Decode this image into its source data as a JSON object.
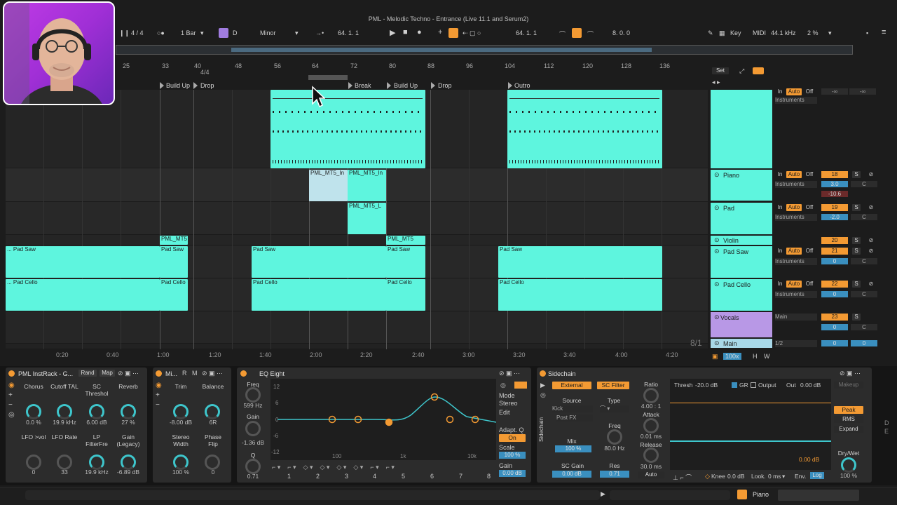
{
  "window": {
    "title": "PML - Melodic Techno - Entrance (Live 11.1 and Serum2)"
  },
  "transport": {
    "time_sig": "4 / 4",
    "quantize": "1 Bar",
    "key": "D",
    "scale": "Minor",
    "position": "64.  1.  1",
    "loop_start": "64.  1.  1",
    "loop_length": "8.  0.  0",
    "key_label": "Key",
    "midi_label": "MIDI",
    "sample_rate": "44.1 kHz",
    "cpu": "2 %"
  },
  "ruler": {
    "bars": [
      "25",
      "33",
      "40",
      "48",
      "56",
      "64",
      "72",
      "80",
      "88",
      "96",
      "104",
      "112",
      "120",
      "128",
      "136"
    ],
    "time_sig_marker": "4/4"
  },
  "locators": [
    "Build Up",
    "Drop",
    "Break",
    "Build Up",
    "Drop",
    "Outro"
  ],
  "clips": {
    "midi_name": "PML_MT5_In",
    "midi_name_2": "PML_MT5_In",
    "midi_name_3": "PML_MT5_L",
    "mt5_short": "PML_MT5",
    "pad_saw": "Pad Saw",
    "pad_cello": "Pad Cello",
    "pad_saw_prefix": "... Pad Saw",
    "pad_cello_prefix": "... Pad Cello"
  },
  "time_ruler": [
    "0:20",
    "0:40",
    "1:00",
    "1:20",
    "1:40",
    "2:00",
    "2:20",
    "2:40",
    "3:00",
    "3:20",
    "3:40",
    "4:00",
    "4:20"
  ],
  "mixer": {
    "set_label": "Set",
    "in": "In",
    "auto": "Auto",
    "off": "Off",
    "instruments": "Instruments",
    "neg_inf": "-∞",
    "tracks": [
      {
        "name": "Piano",
        "number": "18",
        "vol": "3.0",
        "pan": "C",
        "meter": "-10.6"
      },
      {
        "name": "Pad",
        "number": "19",
        "vol": "-2.0",
        "pan": "C",
        "meter": ""
      },
      {
        "name": "Violin",
        "number": "20"
      },
      {
        "name": "Pad Saw",
        "number": "21",
        "vol": "0",
        "pan": "C"
      },
      {
        "name": "Pad Cello",
        "number": "22",
        "vol": "0",
        "pan": "C"
      },
      {
        "name": "Vocals",
        "number": "23",
        "vol": "0",
        "pan": "C",
        "output": "Main"
      },
      {
        "name": "Main",
        "output": "1/2",
        "vol": "0",
        "pan": "0"
      }
    ],
    "s": "S",
    "c": "C",
    "ratio_display": "8/1",
    "zoom": "100x",
    "h": "H",
    "w": "W"
  },
  "devices": {
    "instrack": {
      "title": "PML InstRack - G...",
      "rand": "Rand",
      "map": "Map",
      "params": [
        {
          "label": "Chorus",
          "value": "0.0 %"
        },
        {
          "label": "Cutoff TAL",
          "value": "19.9 kHz"
        },
        {
          "label": "SC Threshol",
          "value": "6.00 dB"
        },
        {
          "label": "Reverb",
          "value": "27 %"
        },
        {
          "label": "LFO >vol",
          "value": "0"
        },
        {
          "label": "LFO Rate",
          "value": "33"
        },
        {
          "label": "LP FilterFre",
          "value": "19.9 kHz"
        },
        {
          "label": "Gain (Legacy)",
          "value": "-6.89 dB"
        }
      ]
    },
    "utility": {
      "title": "Mi...",
      "r": "R",
      "m": "M",
      "params": [
        {
          "label": "Trim",
          "value": "-8.00 dB"
        },
        {
          "label": "Balance",
          "value": "6R"
        },
        {
          "label": "Stereo Width",
          "value": "100 %"
        },
        {
          "label": "Phase Flip",
          "value": "0"
        }
      ]
    },
    "eq": {
      "title": "EQ Eight",
      "freq_label": "Freq",
      "freq_value": "599 Hz",
      "gain_label": "Gain",
      "gain_value": "-1.36 dB",
      "q_label": "Q",
      "q_value": "0.71",
      "db_ticks": [
        "12",
        "6",
        "0",
        "-6",
        "-12"
      ],
      "freq_ticks": [
        "100",
        "1k",
        "10k"
      ],
      "mode_label": "Mode",
      "mode_value": "Stereo",
      "edit_label": "Edit",
      "adapt_label": "Adapt. Q",
      "adapt_value": "On",
      "scale_label": "Scale",
      "scale_value": "100 %",
      "gain_out_label": "Gain",
      "gain_out_value": "0.00 dB",
      "bands": [
        "1",
        "2",
        "3",
        "4",
        "5",
        "6",
        "7",
        "8"
      ]
    },
    "sidechain": {
      "title": "Sidechain",
      "external": "External",
      "sc_filter": "SC Filter",
      "source_label": "Source",
      "source_value": "Kick",
      "source_tap": "Post FX",
      "type_label": "Type",
      "mix_label": "Mix",
      "mix_value": "100 %",
      "freq_label": "Freq",
      "freq_value": "80.0 Hz",
      "sc_gain_label": "SC Gain",
      "sc_gain_value": "0.00 dB",
      "res_label": "Res",
      "res_value": "0.71",
      "ratio_label": "Ratio",
      "ratio_value": "4.00 : 1",
      "attack_label": "Attack",
      "attack_value": "0.01 ms",
      "release_label": "Release",
      "release_value": "30.0 ms",
      "auto": "Auto",
      "thresh": "Thresh",
      "thresh_value": "-20.0 dB",
      "gr": "GR",
      "output": "Output",
      "out_label": "Out",
      "out_value": "0.00 dB",
      "makeup": "Makeup",
      "graph_db": "0.00 dB",
      "peak": "Peak",
      "rms": "RMS",
      "expand": "Expand",
      "knee_label": "Knee",
      "knee_value": "0.0 dB",
      "look_label": "Look.",
      "look_value": "0 ms",
      "env_label": "Env.",
      "env_value": "Log",
      "drywet_label": "Dry/Wet",
      "drywet_value": "100 %",
      "side_label": "Sidechain"
    }
  },
  "status": {
    "track": "Piano"
  }
}
